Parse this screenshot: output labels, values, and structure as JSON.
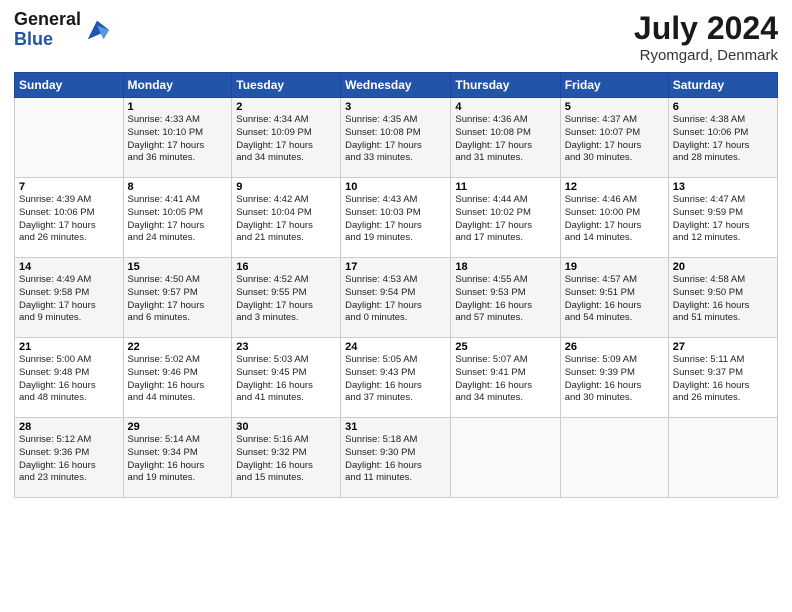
{
  "header": {
    "logo_general": "General",
    "logo_blue": "Blue",
    "title": "July 2024",
    "location": "Ryomgard, Denmark"
  },
  "weekdays": [
    "Sunday",
    "Monday",
    "Tuesday",
    "Wednesday",
    "Thursday",
    "Friday",
    "Saturday"
  ],
  "weeks": [
    [
      {
        "day": "",
        "info": ""
      },
      {
        "day": "1",
        "info": "Sunrise: 4:33 AM\nSunset: 10:10 PM\nDaylight: 17 hours\nand 36 minutes."
      },
      {
        "day": "2",
        "info": "Sunrise: 4:34 AM\nSunset: 10:09 PM\nDaylight: 17 hours\nand 34 minutes."
      },
      {
        "day": "3",
        "info": "Sunrise: 4:35 AM\nSunset: 10:08 PM\nDaylight: 17 hours\nand 33 minutes."
      },
      {
        "day": "4",
        "info": "Sunrise: 4:36 AM\nSunset: 10:08 PM\nDaylight: 17 hours\nand 31 minutes."
      },
      {
        "day": "5",
        "info": "Sunrise: 4:37 AM\nSunset: 10:07 PM\nDaylight: 17 hours\nand 30 minutes."
      },
      {
        "day": "6",
        "info": "Sunrise: 4:38 AM\nSunset: 10:06 PM\nDaylight: 17 hours\nand 28 minutes."
      }
    ],
    [
      {
        "day": "7",
        "info": "Sunrise: 4:39 AM\nSunset: 10:06 PM\nDaylight: 17 hours\nand 26 minutes."
      },
      {
        "day": "8",
        "info": "Sunrise: 4:41 AM\nSunset: 10:05 PM\nDaylight: 17 hours\nand 24 minutes."
      },
      {
        "day": "9",
        "info": "Sunrise: 4:42 AM\nSunset: 10:04 PM\nDaylight: 17 hours\nand 21 minutes."
      },
      {
        "day": "10",
        "info": "Sunrise: 4:43 AM\nSunset: 10:03 PM\nDaylight: 17 hours\nand 19 minutes."
      },
      {
        "day": "11",
        "info": "Sunrise: 4:44 AM\nSunset: 10:02 PM\nDaylight: 17 hours\nand 17 minutes."
      },
      {
        "day": "12",
        "info": "Sunrise: 4:46 AM\nSunset: 10:00 PM\nDaylight: 17 hours\nand 14 minutes."
      },
      {
        "day": "13",
        "info": "Sunrise: 4:47 AM\nSunset: 9:59 PM\nDaylight: 17 hours\nand 12 minutes."
      }
    ],
    [
      {
        "day": "14",
        "info": "Sunrise: 4:49 AM\nSunset: 9:58 PM\nDaylight: 17 hours\nand 9 minutes."
      },
      {
        "day": "15",
        "info": "Sunrise: 4:50 AM\nSunset: 9:57 PM\nDaylight: 17 hours\nand 6 minutes."
      },
      {
        "day": "16",
        "info": "Sunrise: 4:52 AM\nSunset: 9:55 PM\nDaylight: 17 hours\nand 3 minutes."
      },
      {
        "day": "17",
        "info": "Sunrise: 4:53 AM\nSunset: 9:54 PM\nDaylight: 17 hours\nand 0 minutes."
      },
      {
        "day": "18",
        "info": "Sunrise: 4:55 AM\nSunset: 9:53 PM\nDaylight: 16 hours\nand 57 minutes."
      },
      {
        "day": "19",
        "info": "Sunrise: 4:57 AM\nSunset: 9:51 PM\nDaylight: 16 hours\nand 54 minutes."
      },
      {
        "day": "20",
        "info": "Sunrise: 4:58 AM\nSunset: 9:50 PM\nDaylight: 16 hours\nand 51 minutes."
      }
    ],
    [
      {
        "day": "21",
        "info": "Sunrise: 5:00 AM\nSunset: 9:48 PM\nDaylight: 16 hours\nand 48 minutes."
      },
      {
        "day": "22",
        "info": "Sunrise: 5:02 AM\nSunset: 9:46 PM\nDaylight: 16 hours\nand 44 minutes."
      },
      {
        "day": "23",
        "info": "Sunrise: 5:03 AM\nSunset: 9:45 PM\nDaylight: 16 hours\nand 41 minutes."
      },
      {
        "day": "24",
        "info": "Sunrise: 5:05 AM\nSunset: 9:43 PM\nDaylight: 16 hours\nand 37 minutes."
      },
      {
        "day": "25",
        "info": "Sunrise: 5:07 AM\nSunset: 9:41 PM\nDaylight: 16 hours\nand 34 minutes."
      },
      {
        "day": "26",
        "info": "Sunrise: 5:09 AM\nSunset: 9:39 PM\nDaylight: 16 hours\nand 30 minutes."
      },
      {
        "day": "27",
        "info": "Sunrise: 5:11 AM\nSunset: 9:37 PM\nDaylight: 16 hours\nand 26 minutes."
      }
    ],
    [
      {
        "day": "28",
        "info": "Sunrise: 5:12 AM\nSunset: 9:36 PM\nDaylight: 16 hours\nand 23 minutes."
      },
      {
        "day": "29",
        "info": "Sunrise: 5:14 AM\nSunset: 9:34 PM\nDaylight: 16 hours\nand 19 minutes."
      },
      {
        "day": "30",
        "info": "Sunrise: 5:16 AM\nSunset: 9:32 PM\nDaylight: 16 hours\nand 15 minutes."
      },
      {
        "day": "31",
        "info": "Sunrise: 5:18 AM\nSunset: 9:30 PM\nDaylight: 16 hours\nand 11 minutes."
      },
      {
        "day": "",
        "info": ""
      },
      {
        "day": "",
        "info": ""
      },
      {
        "day": "",
        "info": ""
      }
    ]
  ]
}
